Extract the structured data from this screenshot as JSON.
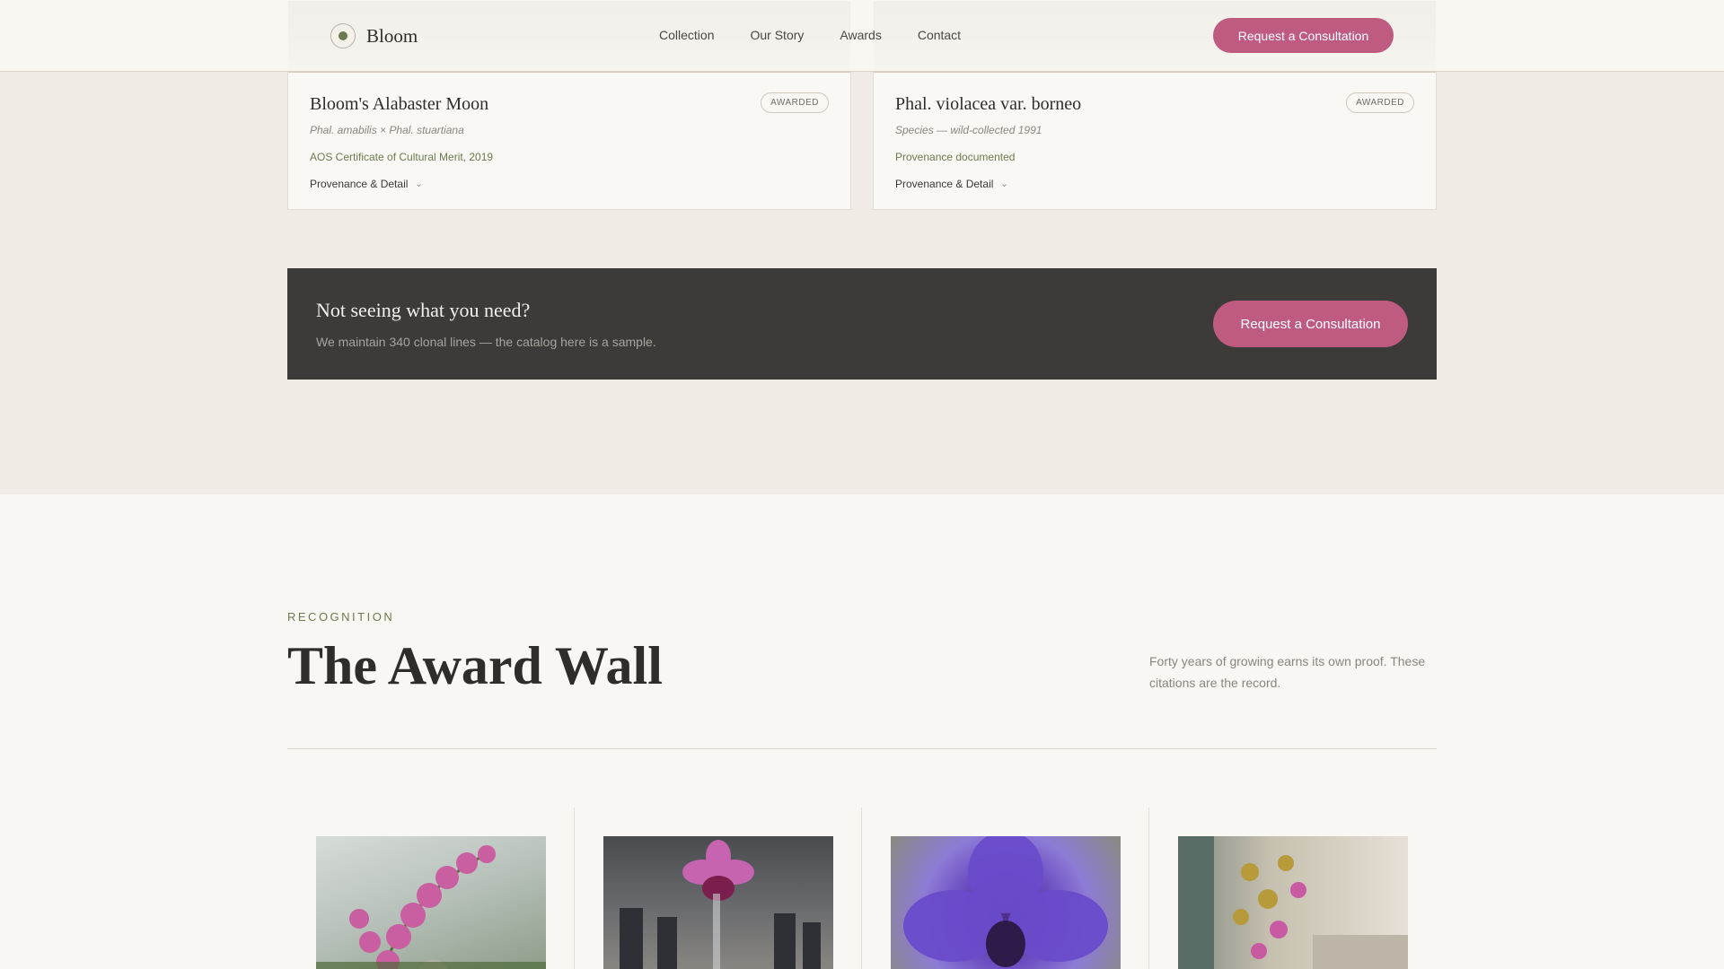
{
  "header": {
    "brand": "Bloom",
    "nav": [
      "Collection",
      "Our Story",
      "Awards",
      "Contact"
    ],
    "cta_label": "Request a Consultation"
  },
  "cards": [
    {
      "name": "Bloom's Alabaster Moon",
      "parentage": "Phal. amabilis × Phal. stuartiana",
      "cert": "AOS Certificate of Cultural Merit, 2019",
      "badge": "AWARDED",
      "detail_label": "Provenance & Detail"
    },
    {
      "name": "Phal. violacea var. borneo",
      "parentage": "Species — wild-collected 1991",
      "cert": "Provenance documented",
      "badge": "AWARDED",
      "detail_label": "Provenance & Detail"
    }
  ],
  "cta_band": {
    "title": "Not seeing what you need?",
    "text": "We maintain 340 clonal lines — the catalog here is a sample.",
    "button": "Request a Consultation"
  },
  "awards": {
    "eyebrow": "RECOGNITION",
    "title": "The Award Wall",
    "intro": "Forty years of growing earns its own proof. These citations are the record."
  },
  "icons": {
    "logo": "orchid-seed-icon",
    "expand": "chevron-down-icon"
  },
  "colors": {
    "accent": "#bf5a80",
    "green": "#6b7a4e",
    "dark_band": "#3c3b3a",
    "page_bg": "#f9f7f3",
    "band_bg": "#f0ebe5"
  }
}
